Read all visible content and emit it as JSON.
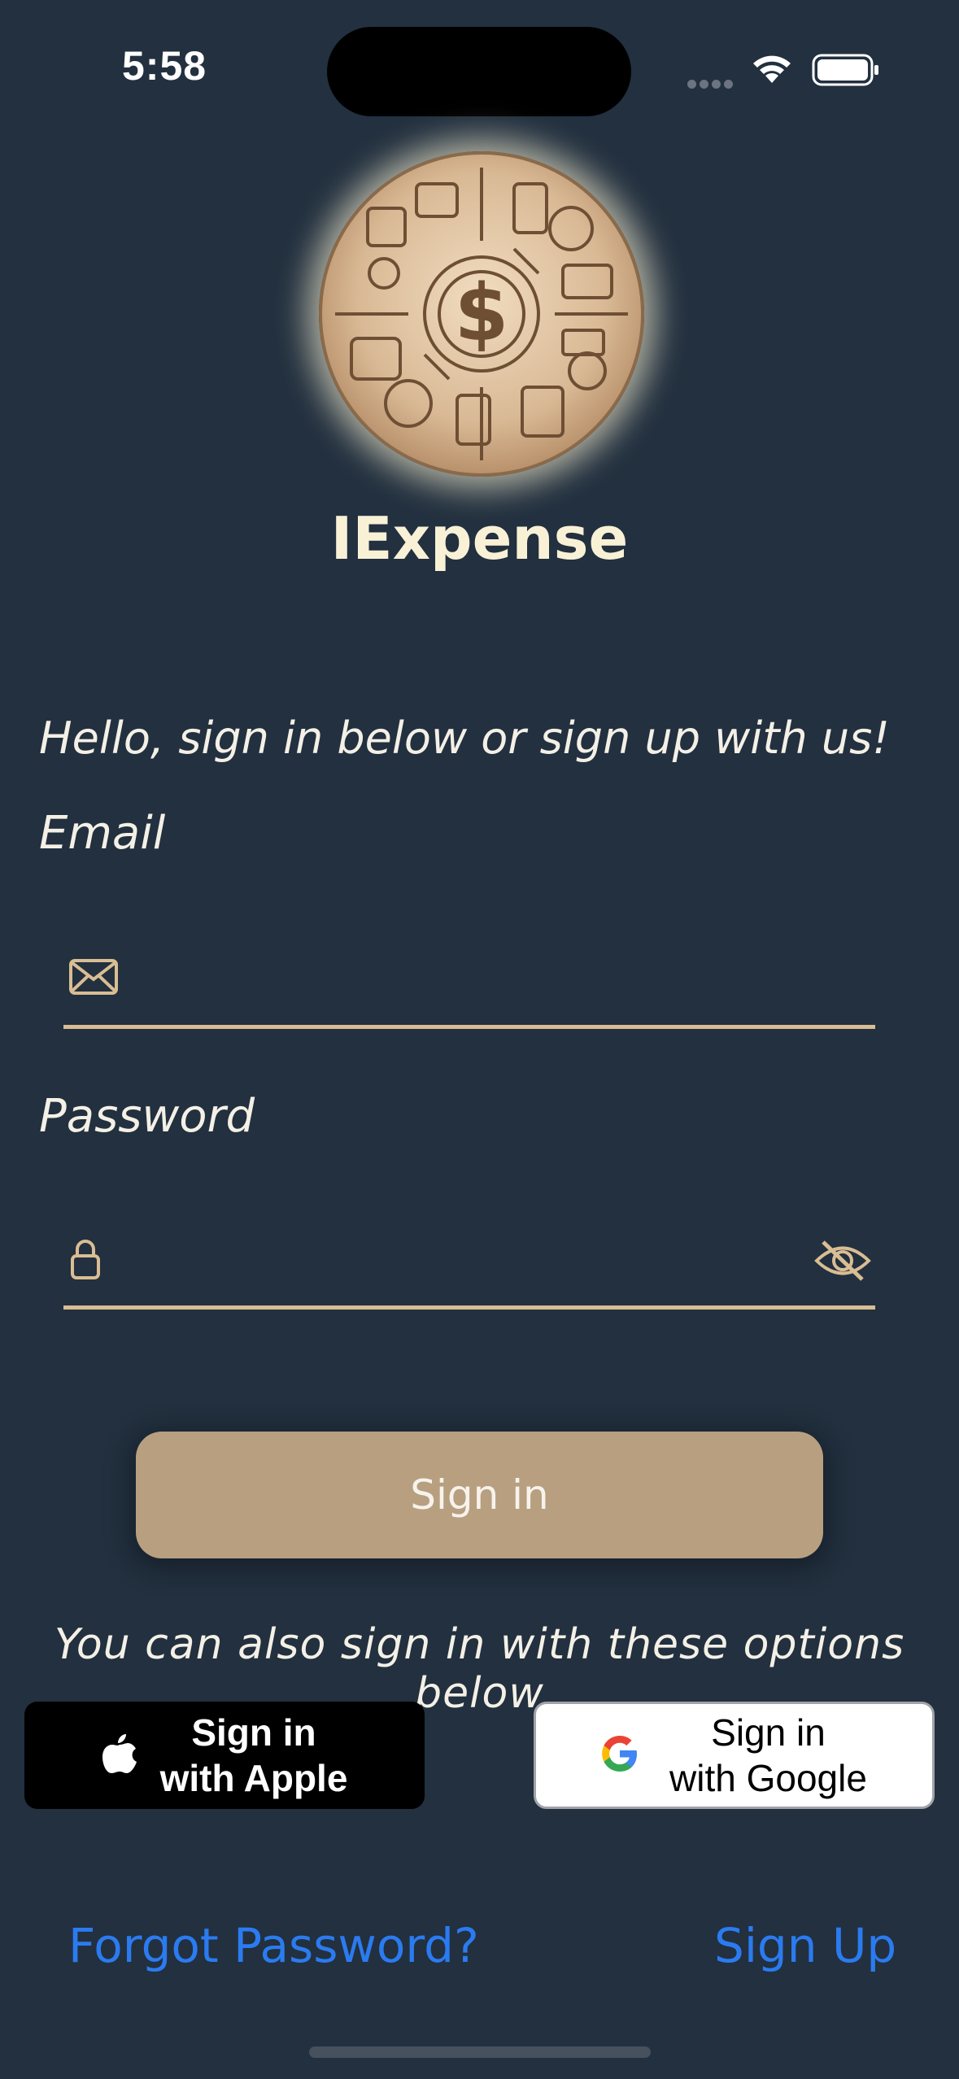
{
  "status_bar": {
    "time": "5:58"
  },
  "app": {
    "title": "IExpense",
    "logo_icon": "coin-logo-icon",
    "colors": {
      "background": "#22303f",
      "accent": "#d9bd93",
      "button": "#b79f80",
      "link": "#2b7bf0"
    }
  },
  "form": {
    "greeting": "Hello, sign in below or sign up with us!",
    "email_label": "Email",
    "email_value": "",
    "password_label": "Password",
    "password_value": "",
    "signin_label": "Sign in"
  },
  "social": {
    "prompt": "You can also sign in with these options below",
    "apple_line1": "Sign in",
    "apple_line2": "with Apple",
    "google_line1": "Sign in",
    "google_line2": "with Google"
  },
  "links": {
    "forgot": "Forgot Password?",
    "signup": "Sign Up"
  }
}
